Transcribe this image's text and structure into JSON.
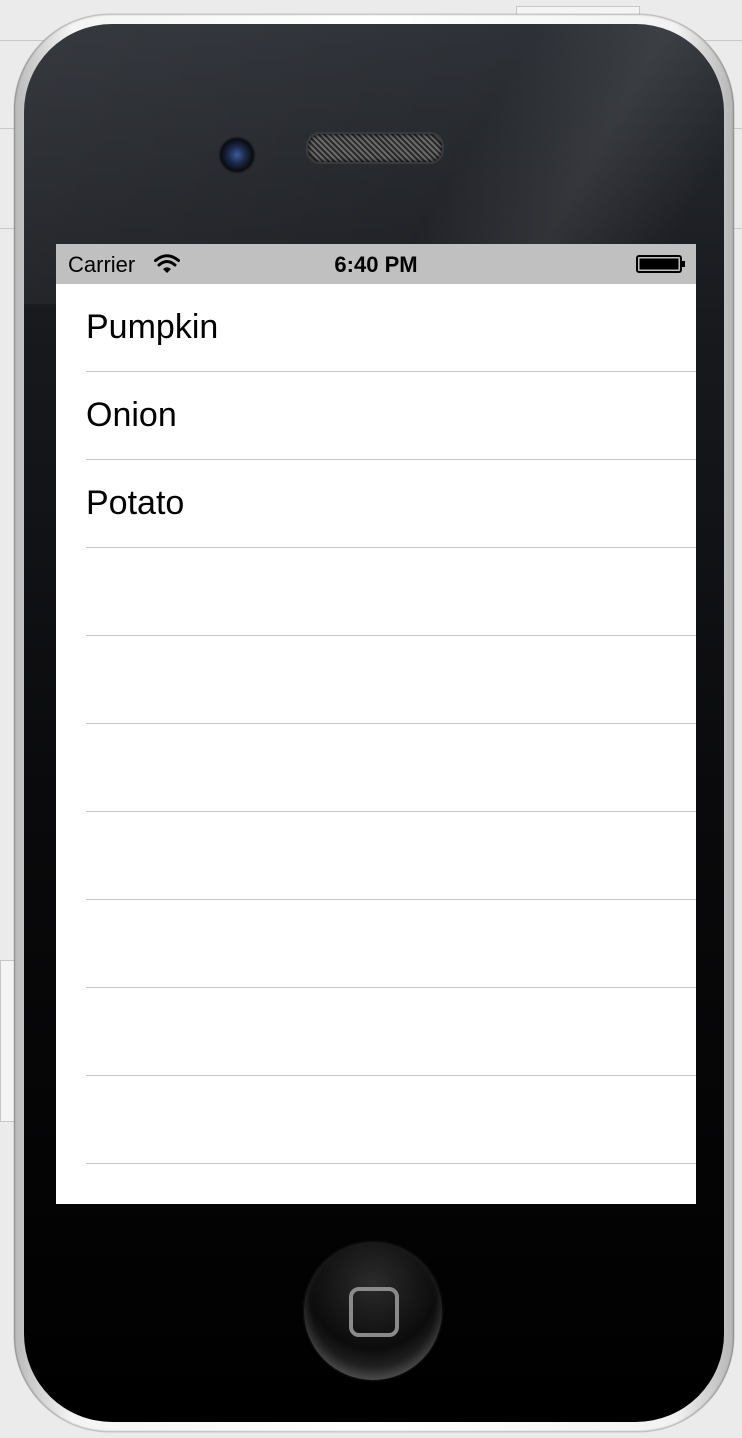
{
  "status_bar": {
    "carrier": "Carrier",
    "time": "6:40 PM",
    "wifi_icon": "wifi-icon",
    "battery_icon": "battery-icon"
  },
  "table": {
    "rows": [
      {
        "label": "Pumpkin"
      },
      {
        "label": "Onion"
      },
      {
        "label": "Potato"
      },
      {
        "label": ""
      },
      {
        "label": ""
      },
      {
        "label": ""
      },
      {
        "label": ""
      },
      {
        "label": ""
      },
      {
        "label": ""
      },
      {
        "label": ""
      }
    ]
  },
  "device": {
    "home_button_icon": "home-square-icon"
  },
  "colors": {
    "status_bar_bg": "#c0c0c0",
    "separator": "#c8c7cc",
    "screen_bg": "#ffffff"
  }
}
